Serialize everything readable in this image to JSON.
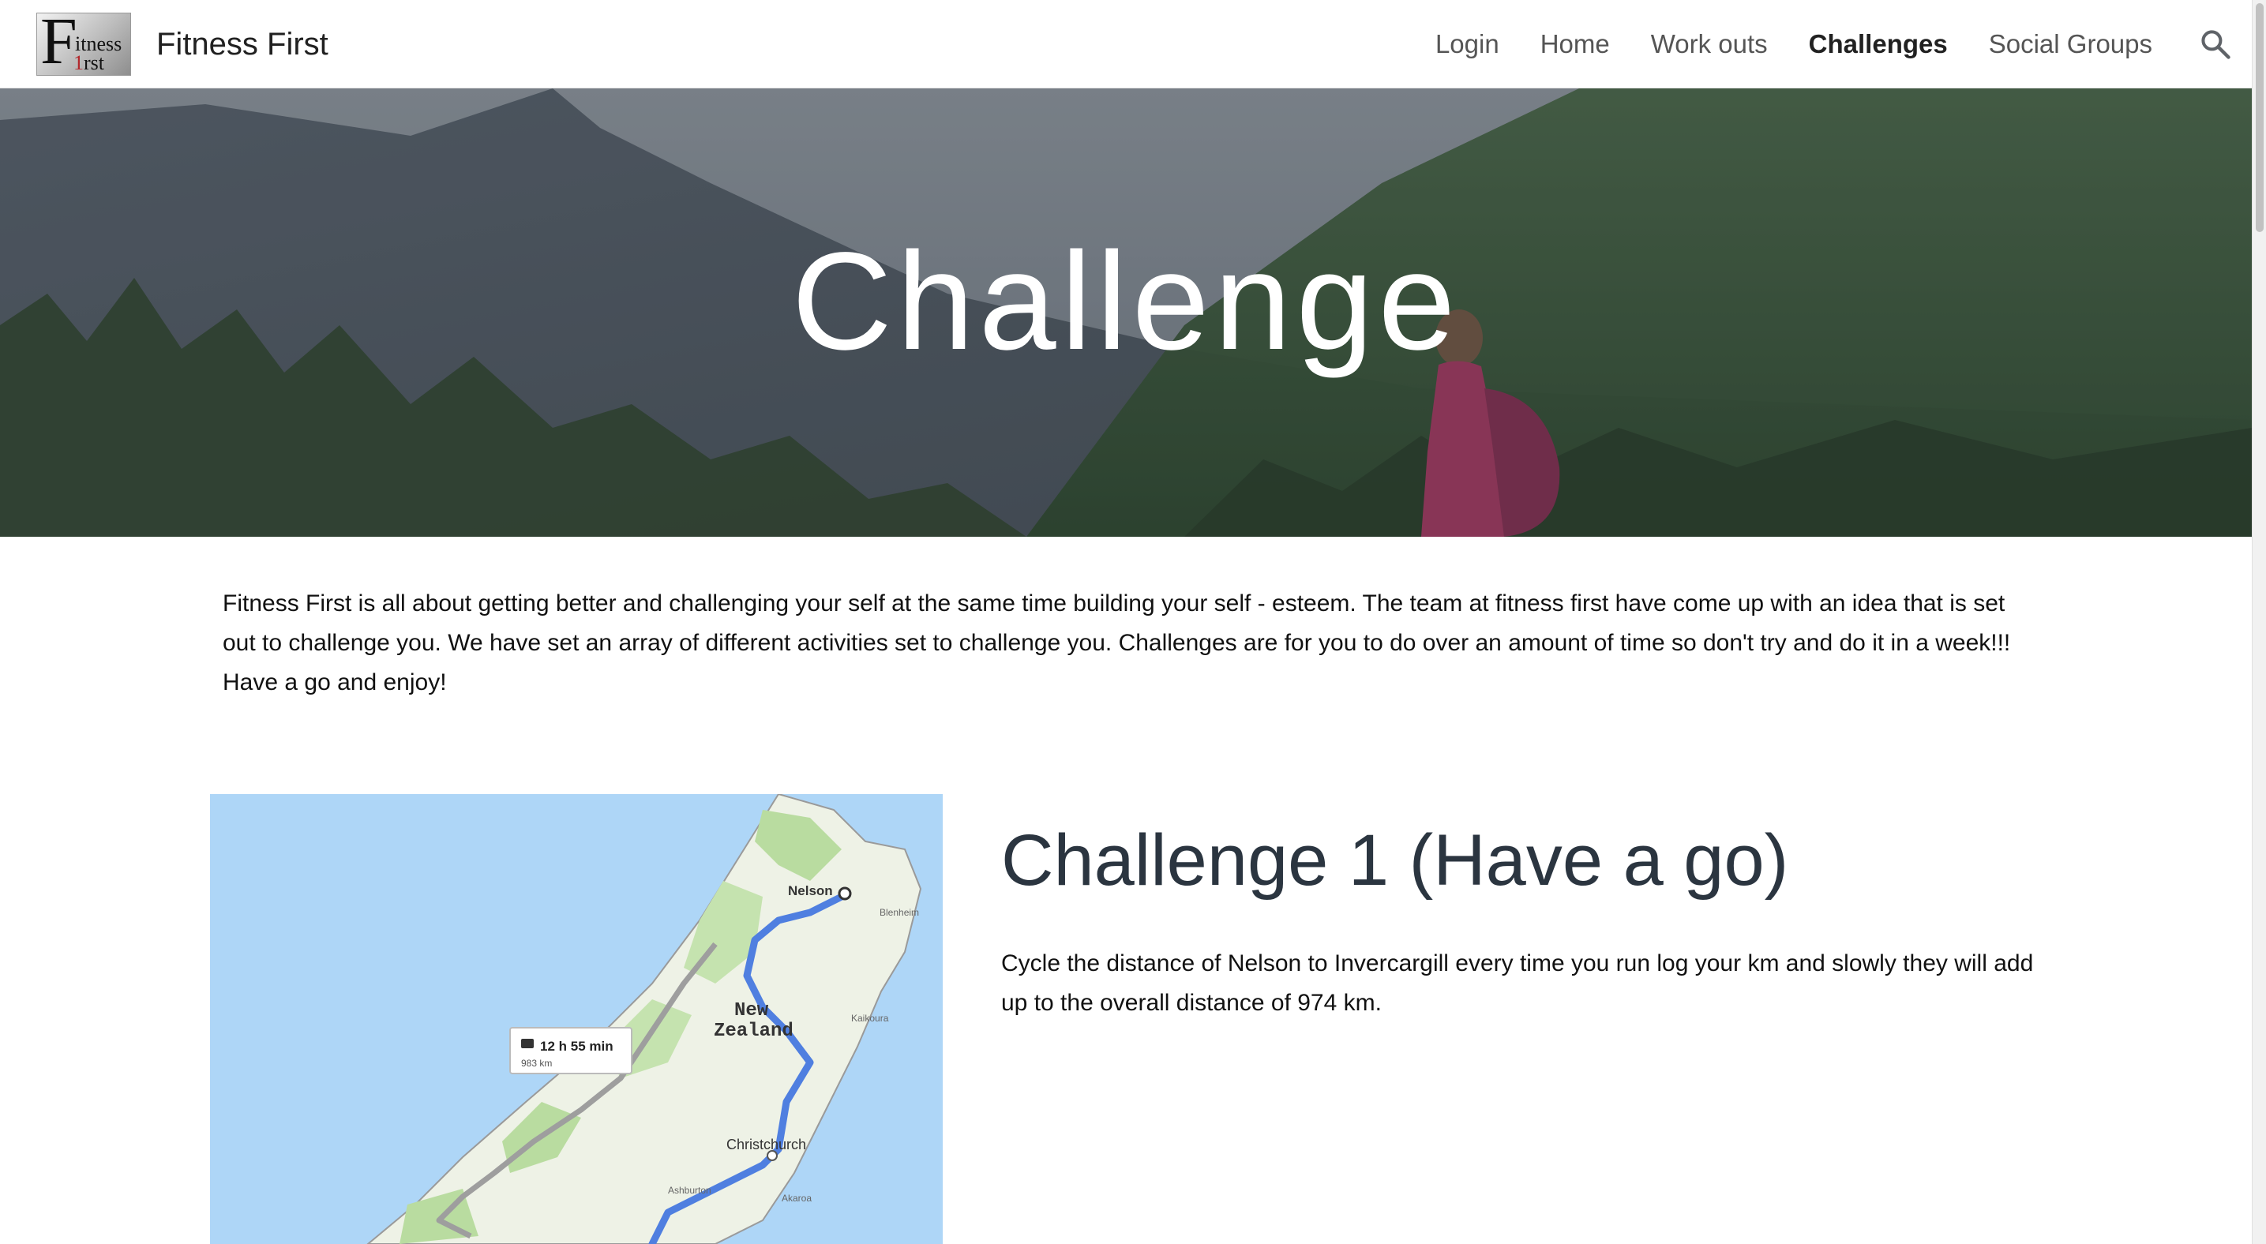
{
  "header": {
    "logo": {
      "big_letter": "F",
      "word1": "itness",
      "word2_red": "1",
      "word2_rest": "rst"
    },
    "site_title": "Fitness First",
    "nav": [
      {
        "label": "Login",
        "active": false
      },
      {
        "label": "Home",
        "active": false
      },
      {
        "label": "Work outs",
        "active": false
      },
      {
        "label": "Challenges",
        "active": true
      },
      {
        "label": "Social Groups",
        "active": false
      }
    ],
    "search_icon": "search-icon"
  },
  "hero": {
    "title": "Challenge"
  },
  "intro": {
    "text": "Fitness First is all about getting better and challenging your self at the same time building your self - esteem.   The team at fitness first have come up with an idea that is set out to challenge you.  We have set an array of different activities set to challenge you.  Challenges are for you to do over an amount of time so don't try and do it in a week!!! Have a go and enjoy!"
  },
  "challenge1": {
    "title": "Challenge 1 (Have a go)",
    "description": "Cycle the distance  of Nelson to Invercargill  every time you run log your km and slowly they will add up to the overall distance of 974 km.",
    "map": {
      "label_nelson": "Nelson",
      "label_blenheim": "Blenheim",
      "label_country_1": "New",
      "label_country_2": "Zealand",
      "label_kaikoura": "Kaikoura",
      "label_christchurch": "Christchurch",
      "label_ashburton": "Ashburton",
      "label_akaroa": "Akaroa",
      "route_time": "12 h 55 min",
      "route_distance": "983 km",
      "car_icon": "car-icon"
    }
  },
  "colors": {
    "active_nav": "#212121",
    "nav": "#555555",
    "route": "#4f7fe0",
    "water": "#a9d3f5",
    "land": "#eef2e6",
    "forest": "#b9dca0"
  }
}
